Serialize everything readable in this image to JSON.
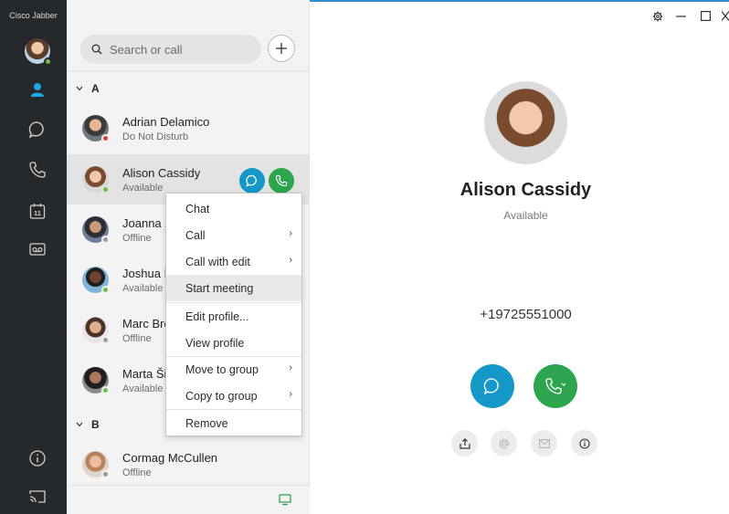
{
  "app": {
    "title": "Cisco Jabber"
  },
  "rail": {
    "user_presence": "available",
    "items": [
      {
        "icon": "contacts-icon",
        "active": true
      },
      {
        "icon": "chat-icon",
        "active": false
      },
      {
        "icon": "phone-icon",
        "active": false
      },
      {
        "icon": "calendar-icon",
        "badge": "11",
        "active": false
      },
      {
        "icon": "voicemail-icon",
        "active": false
      },
      {
        "icon": "info-icon",
        "active": false
      },
      {
        "icon": "cast-icon",
        "active": false
      }
    ]
  },
  "search": {
    "placeholder": "Search or call",
    "value": ""
  },
  "contacts": {
    "groups": [
      {
        "label": "A",
        "items": [
          {
            "name": "Adrian Delamico",
            "status": "Do Not Disturb",
            "presence_color": "#e03c31"
          },
          {
            "name": "Alison Cassidy",
            "status": "Available",
            "presence_color": "#6cc04a",
            "selected": true
          },
          {
            "name": "Joanna X",
            "status": "Offline",
            "presence_color": "#9a9a9a"
          },
          {
            "name": "Joshua I",
            "status": "Available",
            "presence_color": "#6cc04a"
          },
          {
            "name": "Marc Bro",
            "status": "Offline",
            "presence_color": "#9a9a9a"
          },
          {
            "name": "Marta Ši",
            "status": "Available",
            "presence_color": "#6cc04a"
          }
        ]
      },
      {
        "label": "B",
        "items": [
          {
            "name": "Cormag McCullen",
            "status": "Offline",
            "presence_color": "#9a9a9a"
          }
        ]
      }
    ]
  },
  "context_menu": {
    "items": [
      {
        "label": "Chat",
        "submenu": false
      },
      {
        "label": "Call",
        "submenu": true
      },
      {
        "label": "Call with edit",
        "submenu": true
      },
      {
        "label": "Start meeting",
        "submenu": false,
        "hover": true
      },
      {
        "label": "Edit profile...",
        "submenu": false
      },
      {
        "label": "View profile",
        "submenu": false
      },
      {
        "label": "Move to group",
        "submenu": true
      },
      {
        "label": "Copy to group",
        "submenu": true
      },
      {
        "label": "Remove",
        "submenu": false
      }
    ]
  },
  "detail": {
    "name": "Alison Cassidy",
    "status": "Available",
    "phone": "+19725551000",
    "actions": [
      "chat-icon",
      "call-icon"
    ],
    "secondary_actions": [
      "share-icon",
      "at-icon",
      "mail-icon",
      "info-icon"
    ]
  },
  "colors": {
    "rail_bg": "#25292c",
    "chat_blue": "#1597c8",
    "call_green": "#2da44e",
    "accent_line": "#2f8fd0"
  }
}
